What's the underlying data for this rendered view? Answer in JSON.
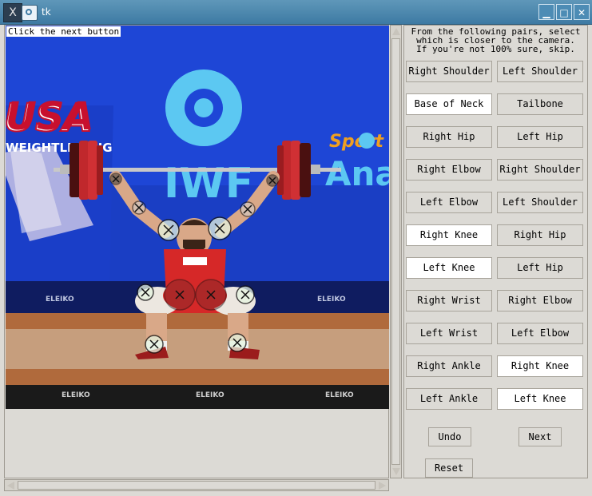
{
  "window": {
    "title": "tk",
    "app_icon": "x-logo-icon",
    "menu_icon": "window-menu-icon",
    "min_symbol": "▁",
    "max_symbol": "□",
    "close_symbol": "✕"
  },
  "canvas": {
    "status": "Click the next button",
    "banner": {
      "usa": "USA",
      "weightlifting": "WEIGHTLIFTING",
      "iwf": "IWF",
      "sponsor": "Sport",
      "sponsor2": "Ana",
      "board_text": "ELEIKO"
    }
  },
  "panel": {
    "instructions": "From the following pairs, select\nwhich is closer to the camera.\nIf you're not 100% sure, skip.",
    "pairs": [
      {
        "left": "Right Shoulder",
        "right": "Left Shoulder",
        "selected": "none"
      },
      {
        "left": "Base of Neck",
        "right": "Tailbone",
        "selected": "left"
      },
      {
        "left": "Right Hip",
        "right": "Left Hip",
        "selected": "none"
      },
      {
        "left": "Right Elbow",
        "right": "Right Shoulder",
        "selected": "none"
      },
      {
        "left": "Left Elbow",
        "right": "Left Shoulder",
        "selected": "none"
      },
      {
        "left": "Right Knee",
        "right": "Right Hip",
        "selected": "left"
      },
      {
        "left": "Left Knee",
        "right": "Left Hip",
        "selected": "left"
      },
      {
        "left": "Right Wrist",
        "right": "Right Elbow",
        "selected": "none"
      },
      {
        "left": "Left Wrist",
        "right": "Left Elbow",
        "selected": "none"
      },
      {
        "left": "Right Ankle",
        "right": "Right Knee",
        "selected": "right"
      },
      {
        "left": "Left Ankle",
        "right": "Left Knee",
        "selected": "right"
      }
    ],
    "undo": "Undo",
    "next": "Next",
    "reset": "Reset"
  }
}
